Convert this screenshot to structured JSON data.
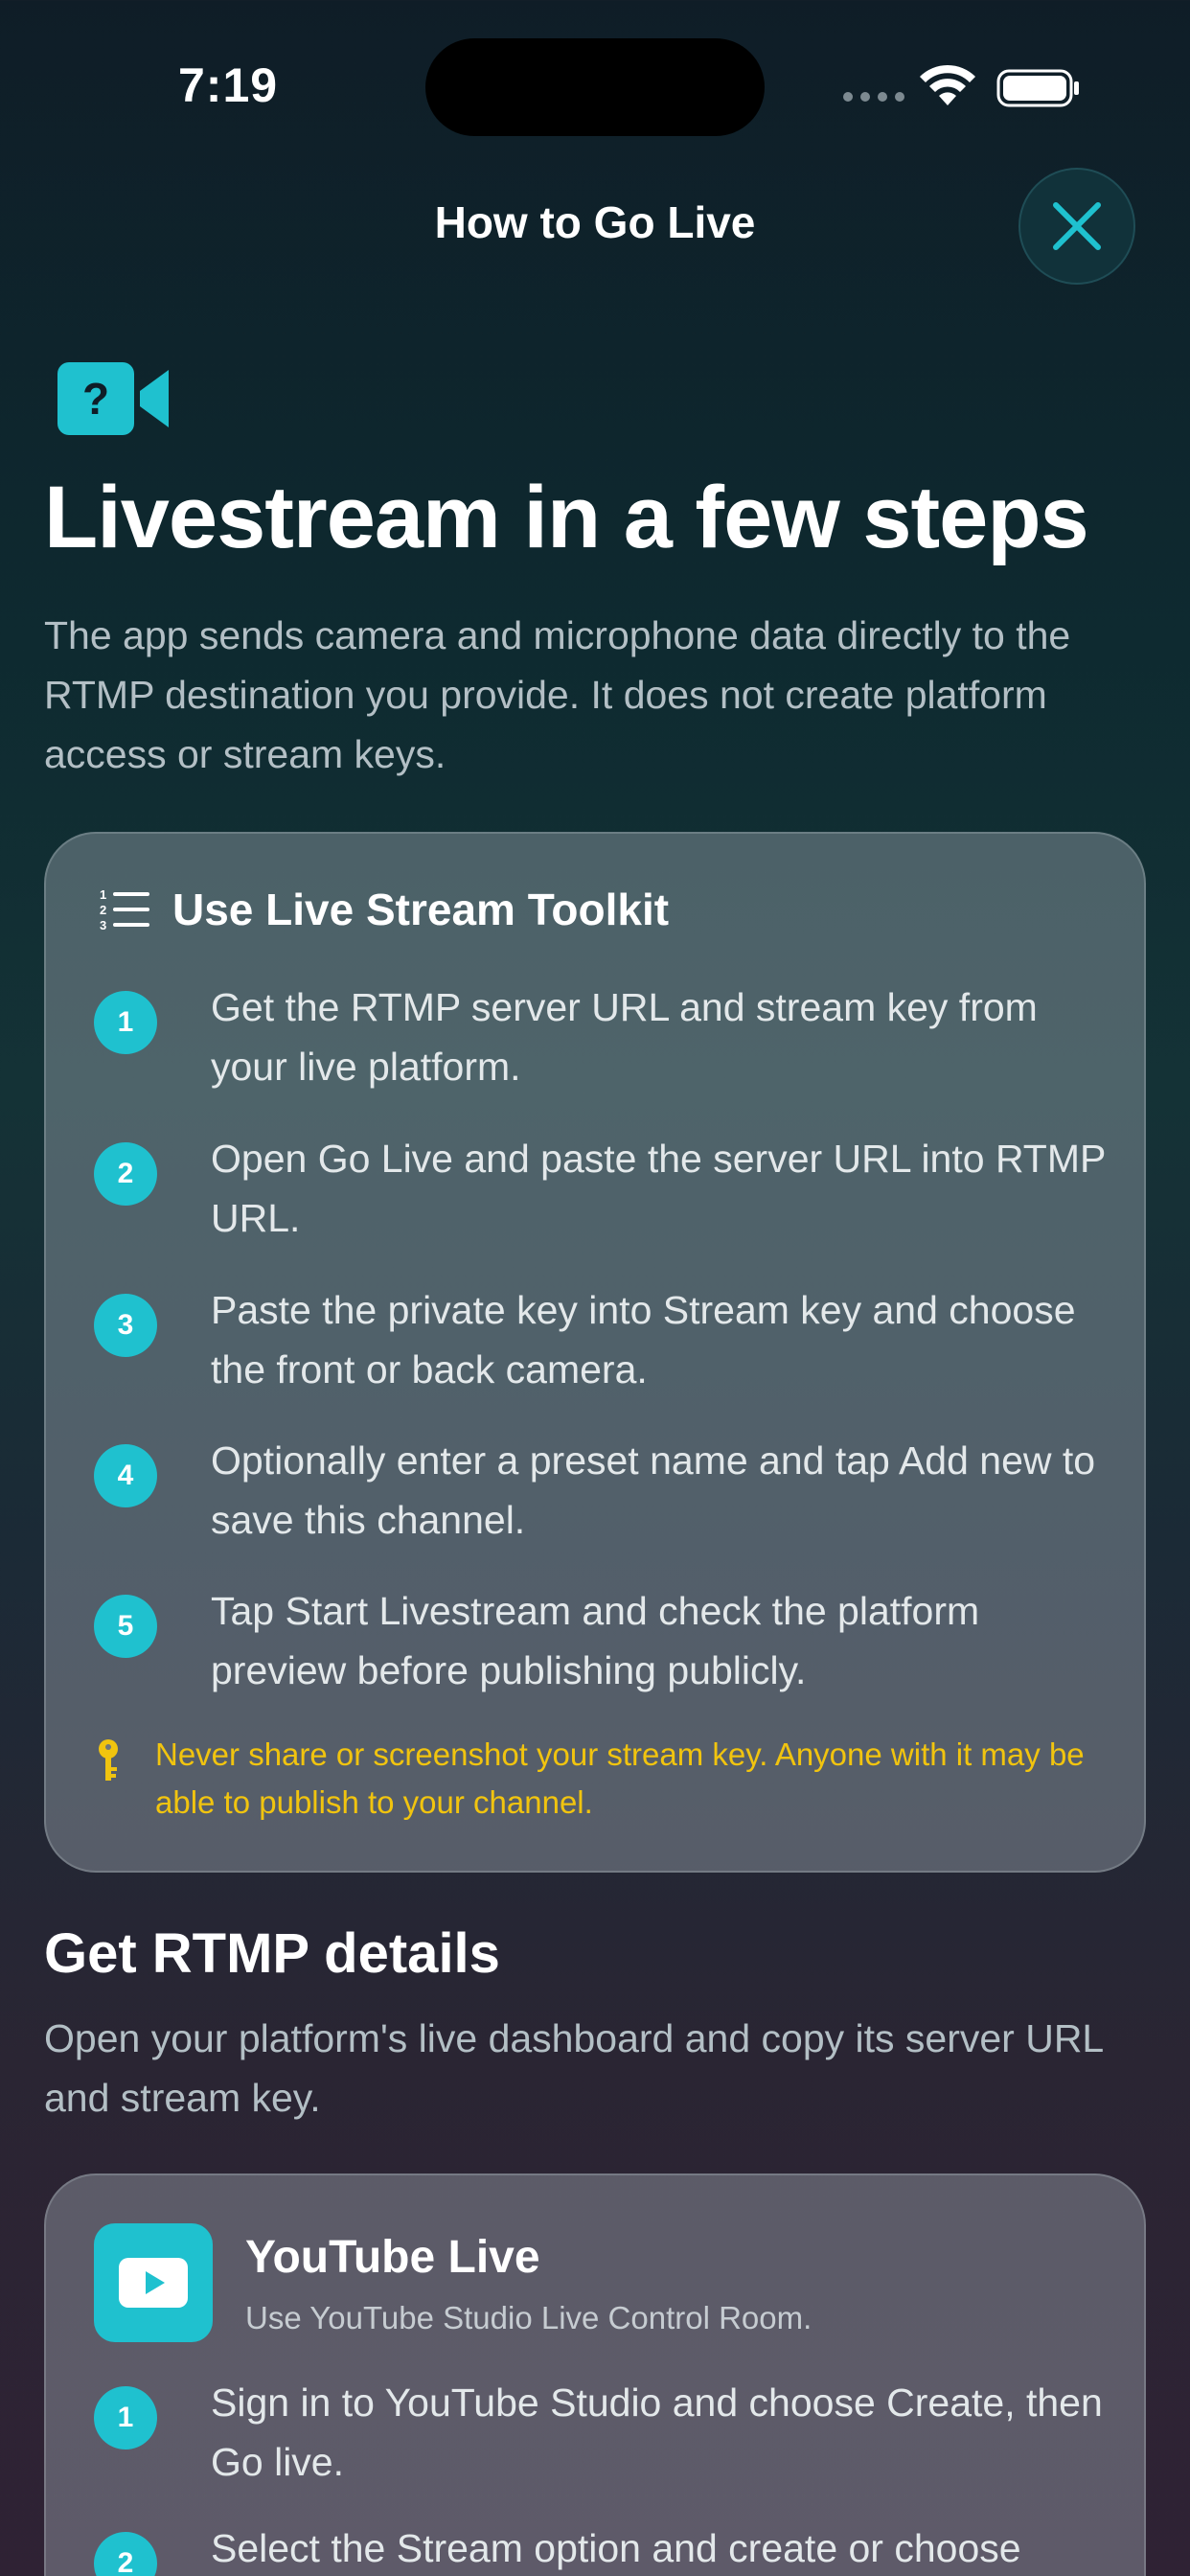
{
  "status_bar": {
    "time": "7:19"
  },
  "header": {
    "title": "How to Go Live",
    "close_icon": "close-icon"
  },
  "hero": {
    "icon": "video-question-icon",
    "title": "Livestream in a few steps",
    "subtitle": "The app sends camera and microphone data directly to the RTMP destination you provide. It does not create platform access or stream keys."
  },
  "toolkit": {
    "icon": "numbered-list-icon",
    "title": "Use Live Stream Toolkit",
    "steps": [
      {
        "number": "1",
        "text": "Get the RTMP server URL and stream key from your live platform."
      },
      {
        "number": "2",
        "text": "Open Go Live and paste the server URL into RTMP URL."
      },
      {
        "number": "3",
        "text": "Paste the private key into Stream key and choose the front or back camera."
      },
      {
        "number": "4",
        "text": "Optionally enter a preset name and tap Add new to save this channel."
      },
      {
        "number": "5",
        "text": "Tap Start Livestream and check the platform preview before publishing publicly."
      }
    ],
    "warning": "Never share or screenshot your stream key. Anyone with it may be able to publish to your channel."
  },
  "rtmp_section": {
    "title": "Get RTMP details",
    "subtitle": "Open your platform's live dashboard and copy its server URL and stream key."
  },
  "youtube": {
    "icon": "youtube-play-icon",
    "title": "YouTube Live",
    "subtitle": "Use YouTube Studio Live Control Room.",
    "steps": [
      {
        "number": "1",
        "text": "Sign in to YouTube Studio and choose Create, then Go live."
      },
      {
        "number": "2",
        "text": "Select the Stream option and create or choose"
      }
    ]
  },
  "colors": {
    "accent": "#1fc1cf",
    "warning": "#f1c40f"
  }
}
